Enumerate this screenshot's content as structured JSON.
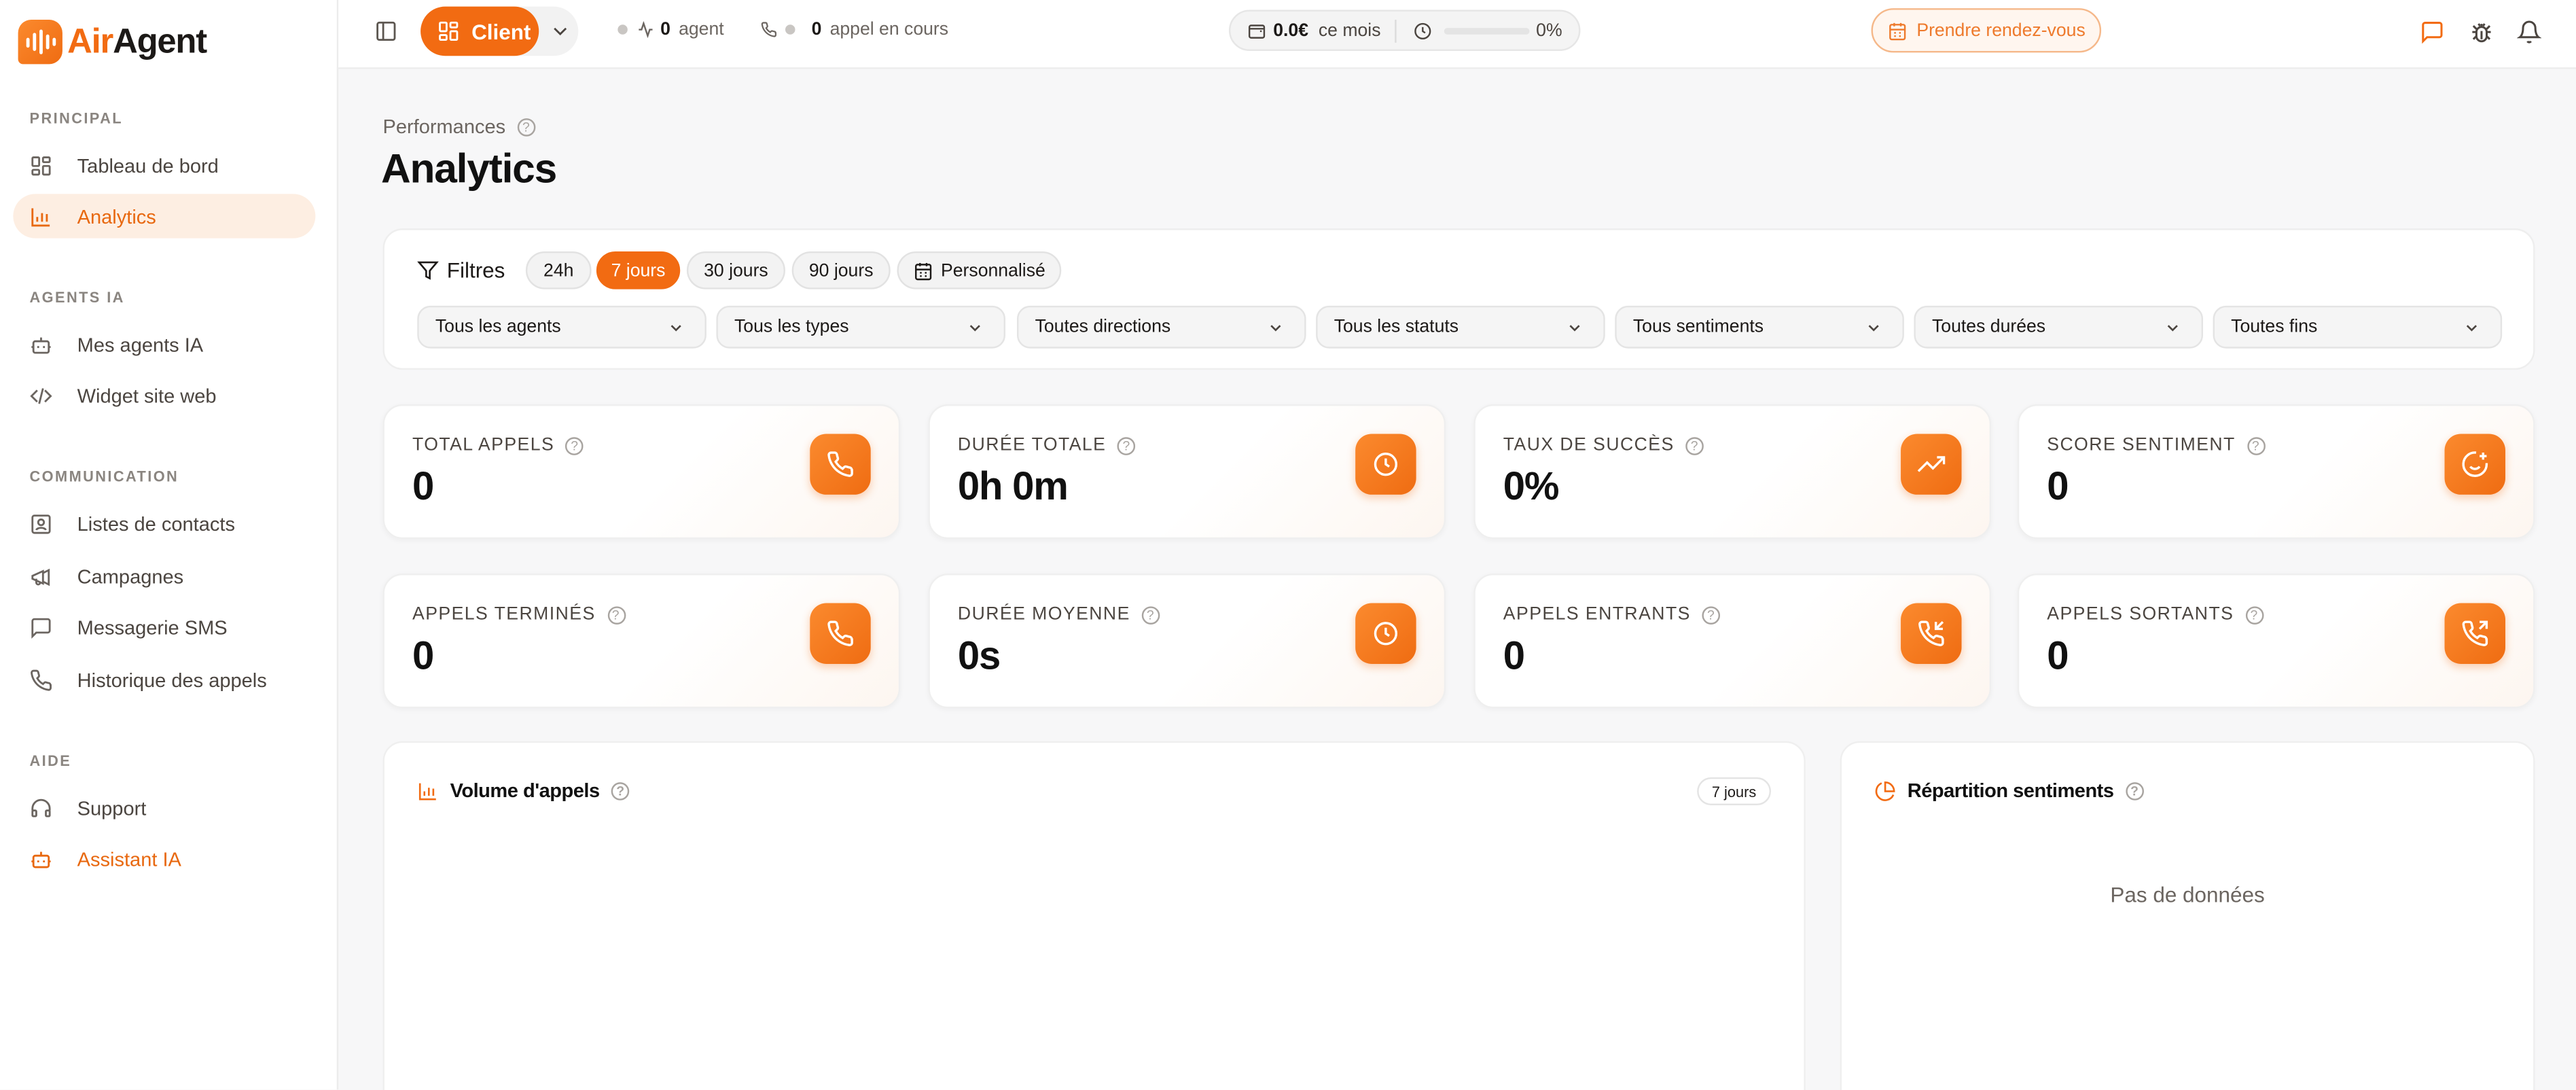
{
  "brand": {
    "name_prefix": "Air",
    "name_suffix": "Agent"
  },
  "sidebar": {
    "sections": [
      {
        "title": "PRINCIPAL",
        "items": [
          {
            "label": "Tableau de bord",
            "icon": "dashboard-icon"
          },
          {
            "label": "Analytics",
            "icon": "bar-chart-icon",
            "active": true
          }
        ]
      },
      {
        "title": "AGENTS IA",
        "items": [
          {
            "label": "Mes agents IA",
            "icon": "bot-icon"
          },
          {
            "label": "Widget site web",
            "icon": "code-icon"
          }
        ]
      },
      {
        "title": "COMMUNICATION",
        "items": [
          {
            "label": "Listes de contacts",
            "icon": "contact-icon"
          },
          {
            "label": "Campagnes",
            "icon": "megaphone-icon"
          },
          {
            "label": "Messagerie SMS",
            "icon": "message-icon"
          },
          {
            "label": "Historique des appels",
            "icon": "phone-icon"
          }
        ]
      },
      {
        "title": "AIDE",
        "items": [
          {
            "label": "Support",
            "icon": "headset-icon"
          },
          {
            "label": "Assistant IA",
            "icon": "bot-icon",
            "accent": true
          }
        ]
      }
    ]
  },
  "topbar": {
    "client_label": "Client",
    "agents_count": "0",
    "agents_label": "agent",
    "calls_count": "0",
    "calls_label": "appel en cours",
    "usage_amount": "0.0€",
    "usage_label": "ce mois",
    "usage_percent_text": "0%",
    "usage_percent": 0,
    "appointment_label": "Prendre rendez-vous"
  },
  "page": {
    "breadcrumb": "Performances",
    "title": "Analytics"
  },
  "filters": {
    "label": "Filtres",
    "ranges": [
      "24h",
      "7 jours",
      "30 jours",
      "90 jours"
    ],
    "active_range": "7 jours",
    "custom_label": "Personnalisé",
    "selects": [
      "Tous les agents",
      "Tous les types",
      "Toutes directions",
      "Tous les statuts",
      "Tous sentiments",
      "Toutes durées",
      "Toutes fins"
    ]
  },
  "kpis": [
    {
      "label": "TOTAL APPELS",
      "value": "0",
      "icon": "phone-icon"
    },
    {
      "label": "DURÉE TOTALE",
      "value": "0h 0m",
      "icon": "clock-icon"
    },
    {
      "label": "TAUX DE SUCCÈS",
      "value": "0%",
      "icon": "trending-up-icon"
    },
    {
      "label": "SCORE SENTIMENT",
      "value": "0",
      "icon": "smile-plus-icon"
    },
    {
      "label": "APPELS TERMINÉS",
      "value": "0",
      "icon": "phone-icon"
    },
    {
      "label": "DURÉE MOYENNE",
      "value": "0s",
      "icon": "clock-icon"
    },
    {
      "label": "APPELS ENTRANTS",
      "value": "0",
      "icon": "phone-incoming-icon"
    },
    {
      "label": "APPELS SORTANTS",
      "value": "0",
      "icon": "phone-outgoing-icon"
    }
  ],
  "panels": {
    "volume": {
      "title": "Volume d'appels",
      "range": "7 jours"
    },
    "sentiment": {
      "title": "Répartition sentiments",
      "empty": "Pas de données"
    }
  },
  "colors": {
    "accent": "#f26b12",
    "accent_soft": "#fdeee2"
  }
}
